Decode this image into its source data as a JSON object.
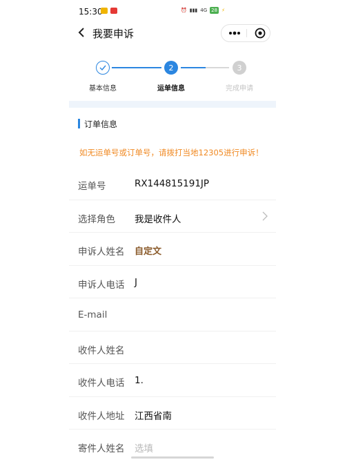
{
  "status_bar": {
    "time": "15:30",
    "right_text": "4G",
    "battery": "28"
  },
  "nav": {
    "title": "我要申诉"
  },
  "stepper": {
    "steps": [
      {
        "label": "基本信息",
        "state": "done",
        "number": "✓"
      },
      {
        "label": "运单信息",
        "state": "active",
        "number": "2"
      },
      {
        "label": "完成申请",
        "state": "pending",
        "number": "3"
      }
    ],
    "colors": {
      "active": "#2b86e0",
      "pending": "#c8c8c8"
    }
  },
  "section": {
    "title": "订单信息"
  },
  "notice": "如无运单号或订单号，请拨打当地12305进行申诉！",
  "form": {
    "rows": [
      {
        "label": "运单号",
        "value": "RX144815191JP"
      },
      {
        "label": "选择角色",
        "value": "我是收件人"
      },
      {
        "label": "申诉人姓名",
        "value": "自定文"
      },
      {
        "label": "申诉人电话",
        "value": "J"
      },
      {
        "label": "E-mail",
        "value": ""
      },
      {
        "label": "收件人姓名",
        "value": ""
      },
      {
        "label": "收件人电话",
        "value": "1."
      },
      {
        "label": "收件人地址",
        "value": "江西省南"
      },
      {
        "label": "寄件人姓名",
        "placeholder": "选填"
      }
    ]
  }
}
